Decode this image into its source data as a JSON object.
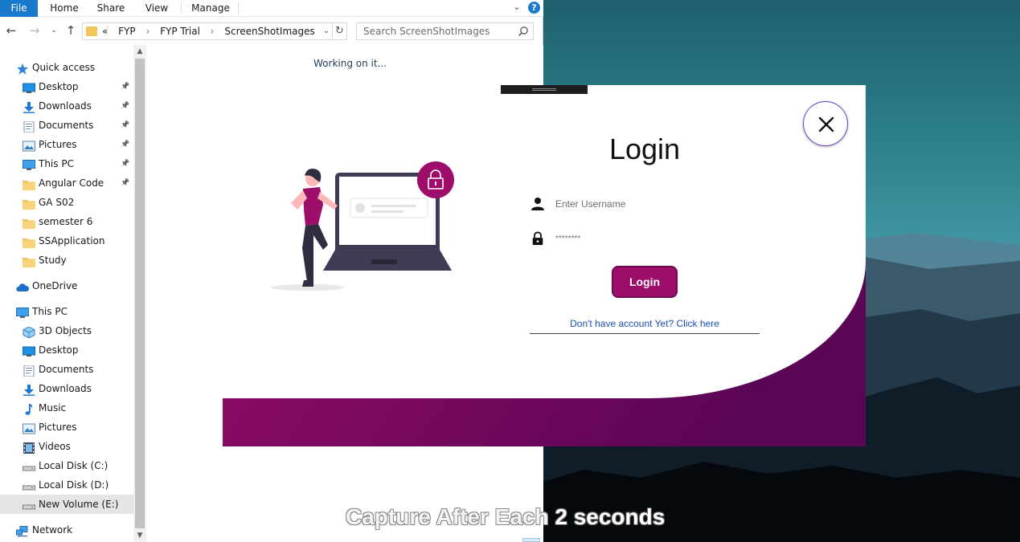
{
  "ribbon": {
    "tabs": [
      "File",
      "Home",
      "Share",
      "View",
      "Manage"
    ],
    "help": "?"
  },
  "navbar": {
    "breadcrumb": [
      "«",
      "FYP",
      "FYP Trial",
      "ScreenShotImages"
    ],
    "search_placeholder": "Search ScreenShotImages"
  },
  "sidebar": {
    "items": [
      {
        "label": "Quick access",
        "icon": "star-icon",
        "pinned": false
      },
      {
        "label": "Desktop",
        "icon": "desktop-folder-icon",
        "pinned": true
      },
      {
        "label": "Downloads",
        "icon": "download-arrow-icon",
        "pinned": true
      },
      {
        "label": "Documents",
        "icon": "documents-icon",
        "pinned": true
      },
      {
        "label": "Pictures",
        "icon": "pictures-icon",
        "pinned": true
      },
      {
        "label": "This PC",
        "icon": "monitor-icon",
        "pinned": true
      },
      {
        "label": "Angular Code",
        "icon": "folder-icon",
        "pinned": true
      },
      {
        "label": "GA S02",
        "icon": "folder-icon",
        "pinned": false
      },
      {
        "label": "semester 6",
        "icon": "folder-icon",
        "pinned": false
      },
      {
        "label": "SSApplication",
        "icon": "folder-icon",
        "pinned": false
      },
      {
        "label": "Study",
        "icon": "folder-icon",
        "pinned": false
      },
      {
        "label": "OneDrive",
        "icon": "cloud-icon",
        "pinned": false
      },
      {
        "label": "This PC",
        "icon": "monitor-icon",
        "pinned": false
      },
      {
        "label": "3D Objects",
        "icon": "cube-icon",
        "pinned": false
      },
      {
        "label": "Desktop",
        "icon": "desktop-folder-icon",
        "pinned": false
      },
      {
        "label": "Documents",
        "icon": "documents-icon",
        "pinned": false
      },
      {
        "label": "Downloads",
        "icon": "download-arrow-icon",
        "pinned": false
      },
      {
        "label": "Music",
        "icon": "music-note-icon",
        "pinned": false
      },
      {
        "label": "Pictures",
        "icon": "pictures-icon",
        "pinned": false
      },
      {
        "label": "Videos",
        "icon": "film-icon",
        "pinned": false
      },
      {
        "label": "Local Disk (C:)",
        "icon": "drive-icon",
        "pinned": false
      },
      {
        "label": "Local Disk (D:)",
        "icon": "drive-icon",
        "pinned": false
      },
      {
        "label": "New Volume (E:)",
        "icon": "drive-icon",
        "pinned": false,
        "selected": true
      },
      {
        "label": "Network",
        "icon": "network-icon",
        "pinned": false
      }
    ]
  },
  "content": {
    "status": "Working on it..."
  },
  "login": {
    "title": "Login",
    "username_placeholder": "Enter Username",
    "password_value": "********",
    "button_label": "Login",
    "signup_link": "Don't have account Yet? Click here",
    "accent_color": "#9d0d69"
  },
  "caption": {
    "faded": "Capture After Each",
    "bold": "2 seconds"
  },
  "colors": {
    "file_tab": "#1979ca",
    "selected_item": "#cce8ff",
    "gradient_start": "#9d0d69",
    "gradient_end": "#5b0556"
  }
}
